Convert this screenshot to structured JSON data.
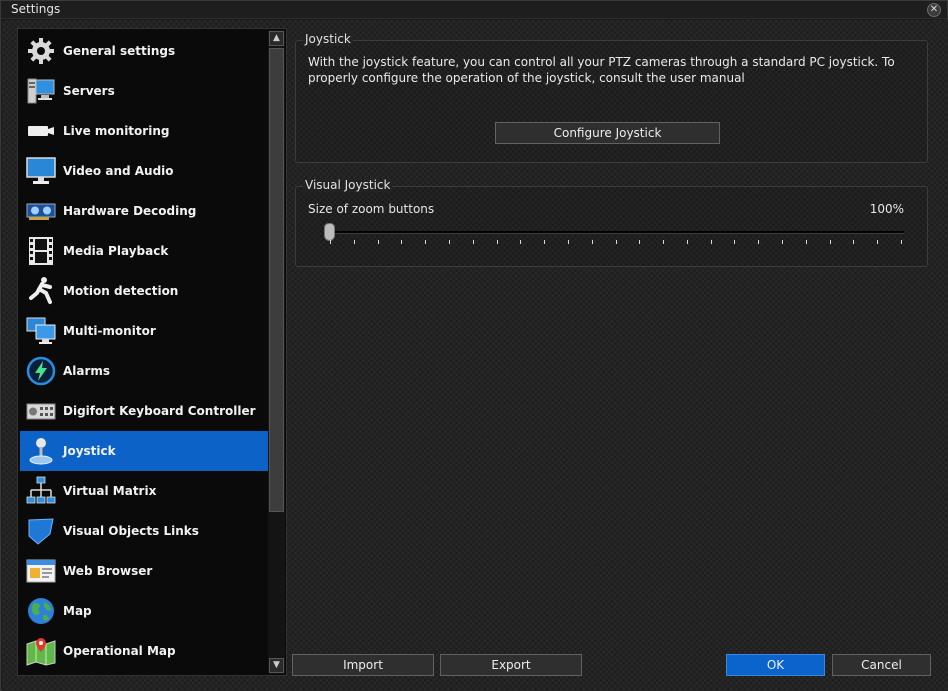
{
  "window": {
    "title": "Settings"
  },
  "sidebar": {
    "items": [
      {
        "label": "General settings",
        "icon": "gear-icon",
        "active": false
      },
      {
        "label": "Servers",
        "icon": "server-icon",
        "active": false
      },
      {
        "label": "Live monitoring",
        "icon": "camera-icon",
        "active": false
      },
      {
        "label": "Video and Audio",
        "icon": "monitor-icon",
        "active": false
      },
      {
        "label": "Hardware Decoding",
        "icon": "gpu-card-icon",
        "active": false
      },
      {
        "label": "Media Playback",
        "icon": "film-strip-icon",
        "active": false
      },
      {
        "label": "Motion detection",
        "icon": "running-person-icon",
        "active": false
      },
      {
        "label": "Multi-monitor",
        "icon": "multi-monitor-icon",
        "active": false
      },
      {
        "label": "Alarms",
        "icon": "alarm-bolt-icon",
        "active": false
      },
      {
        "label": "Digifort Keyboard Controller",
        "icon": "keyboard-controller-icon",
        "active": false
      },
      {
        "label": "Joystick",
        "icon": "joystick-icon",
        "active": true
      },
      {
        "label": "Virtual Matrix",
        "icon": "network-icon",
        "active": false
      },
      {
        "label": "Visual Objects Links",
        "icon": "visual-object-icon",
        "active": false
      },
      {
        "label": "Web Browser",
        "icon": "web-browser-icon",
        "active": false
      },
      {
        "label": "Map",
        "icon": "globe-icon",
        "active": false
      },
      {
        "label": "Operational Map",
        "icon": "operational-map-icon",
        "active": false
      }
    ]
  },
  "joystick": {
    "group_title": "Joystick",
    "description": "With the joystick feature, you can control all your PTZ cameras through a standard PC joystick. To properly configure the operation of the joystick, consult the user manual",
    "configure_button": "Configure Joystick"
  },
  "visual_joystick": {
    "group_title": "Visual Joystick",
    "zoom_label": "Size of zoom buttons",
    "zoom_value": "100%",
    "slider_level": 0,
    "tick_count": 25
  },
  "footer": {
    "import_label": "Import",
    "export_label": "Export",
    "ok_label": "OK",
    "cancel_label": "Cancel"
  },
  "colors": {
    "accent": "#0d62c8",
    "background": "#232323",
    "sidebar_bg": "#0a0a0a"
  }
}
